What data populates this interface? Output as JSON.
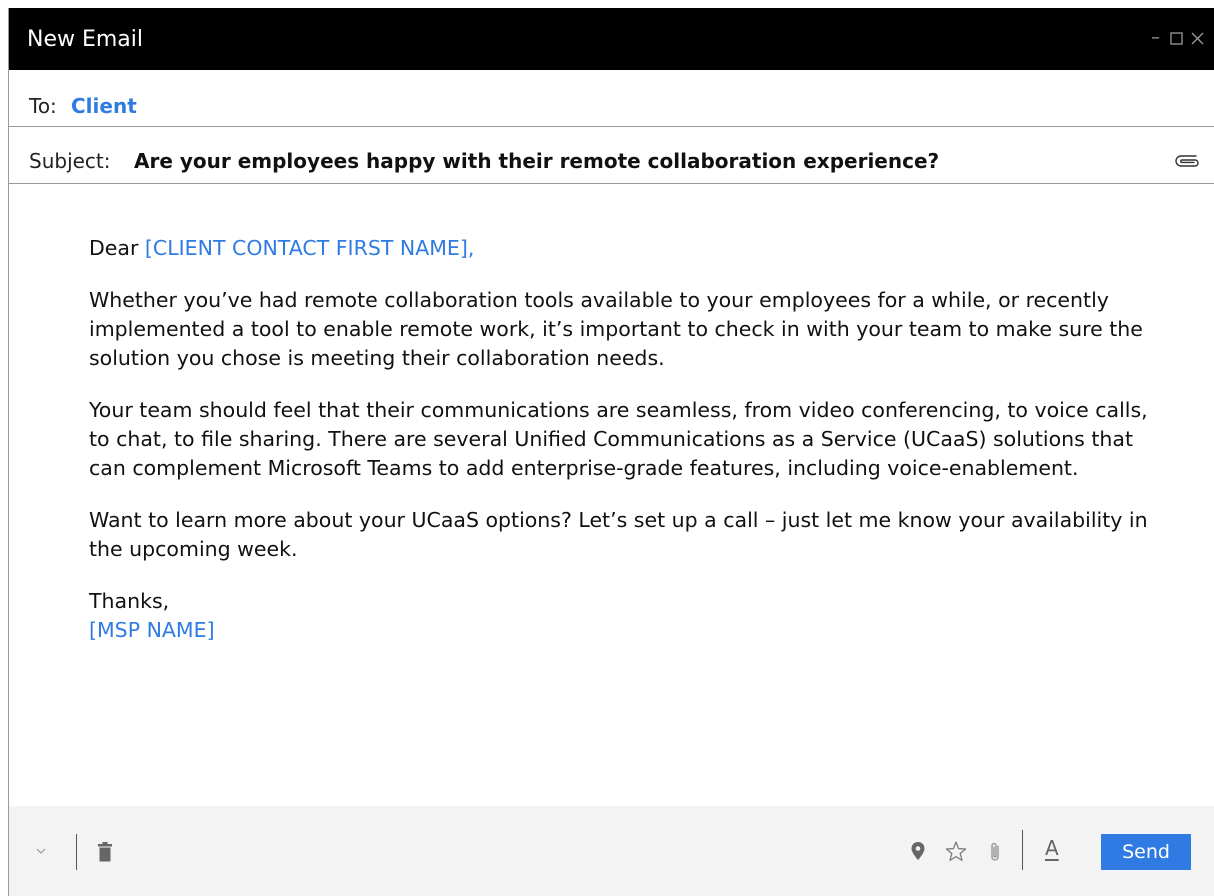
{
  "window": {
    "title": "New Email",
    "controls": {
      "minimize": "–"
    }
  },
  "to": {
    "label": "To:",
    "value": "Client"
  },
  "subject": {
    "label": "Subject:",
    "value": "Are your employees happy with their remote collaboration experience?"
  },
  "body": {
    "greeting_prefix": "Dear ",
    "greeting_placeholder": "[CLIENT CONTACT FIRST NAME],",
    "paragraph1": "Whether you’ve had remote collaboration tools available to your employees for a while, or recently implemented a tool to enable remote work, it’s important to check in with your team to make sure the solution you chose is meeting their collaboration needs.",
    "paragraph2": "Your team should feel that their communications are seamless, from video conferencing, to voice calls, to chat, to file sharing. There are several Unified Communications as a Service (UCaaS) solutions that can complement Microsoft Teams to add enterprise-grade features, including voice-enablement.",
    "paragraph3": "Want to learn more about your UCaaS options? Let’s set up a call – just let me know your availability in the upcoming week.",
    "signoff": "Thanks,",
    "signature_placeholder": "[MSP NAME]"
  },
  "footer": {
    "font_label": "A",
    "send_label": "Send"
  },
  "colors": {
    "accent": "#2f7be3",
    "titlebar": "#000000",
    "footer_bg": "#f3f3f3"
  },
  "icons": {
    "attach": "paperclip-icon",
    "chevron": "chevron-down-icon",
    "trash": "trash-icon",
    "location": "location-pin-icon",
    "favorite": "star-icon",
    "attach_footer": "paperclip-icon",
    "format": "font-color-icon"
  }
}
